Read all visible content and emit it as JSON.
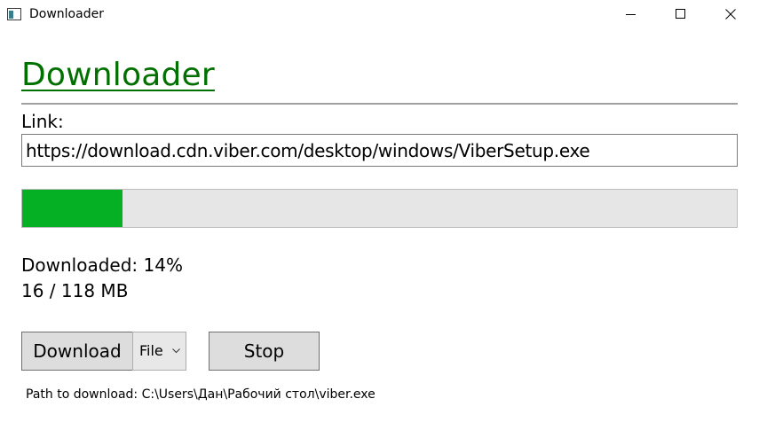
{
  "window": {
    "title": "Downloader"
  },
  "header": {
    "title": "Downloader"
  },
  "link": {
    "label": "Link:",
    "value": "https://download.cdn.viber.com/desktop/windows/ViberSetup.exe"
  },
  "progress": {
    "percent": 14,
    "fill_color": "#06b025",
    "track_color": "#e6e6e6"
  },
  "status": {
    "downloaded": "Downloaded: 14%",
    "size": "16 / 118 MB"
  },
  "actions": {
    "download_label": "Download",
    "mode_selected": "File",
    "stop_label": "Stop"
  },
  "footer": {
    "path": "Path to download: C:\\Users\\Дан\\Рабочий стол\\viber.exe"
  },
  "icons": {
    "app": "window-app-icon",
    "minimize": "minimize-icon",
    "maximize": "maximize-icon",
    "close": "close-icon",
    "dropdown": "chevron-down-icon"
  }
}
